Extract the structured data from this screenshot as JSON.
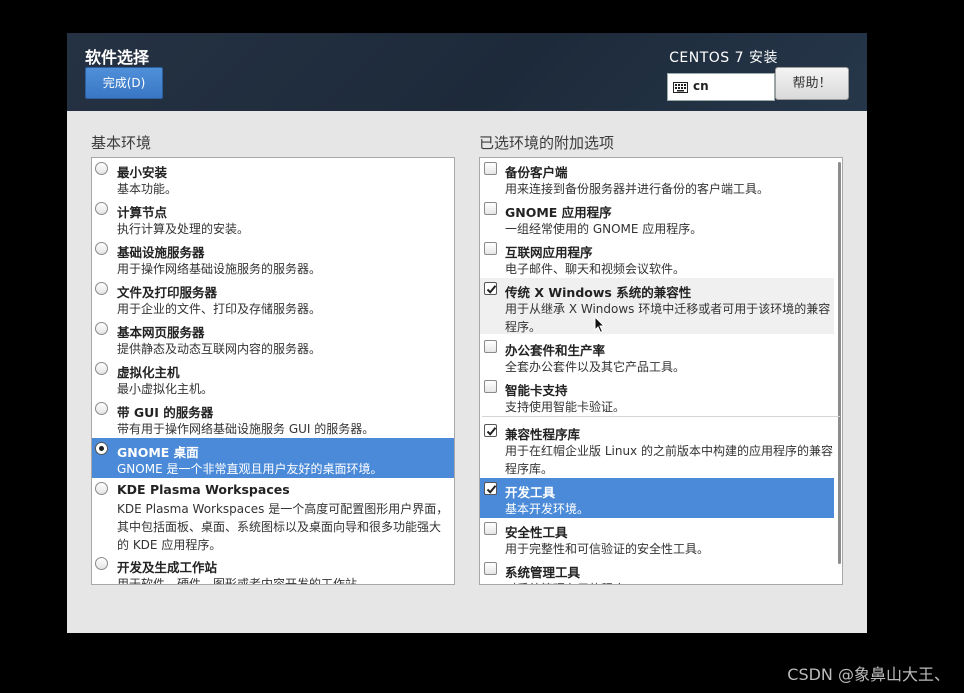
{
  "header": {
    "title": "软件选择",
    "done_label": "完成(D)",
    "product": "CENTOS 7 安装",
    "keyboard_layout": "cn",
    "help_label": "帮助！"
  },
  "base_env": {
    "label": "基本环境",
    "selected_index": 7,
    "items": [
      {
        "name": "最小安装",
        "desc": "基本功能。"
      },
      {
        "name": "计算节点",
        "desc": "执行计算及处理的安装。"
      },
      {
        "name": "基础设施服务器",
        "desc": "用于操作网络基础设施服务的服务器。"
      },
      {
        "name": "文件及打印服务器",
        "desc": "用于企业的文件、打印及存储服务器。"
      },
      {
        "name": "基本网页服务器",
        "desc": "提供静态及动态互联网内容的服务器。"
      },
      {
        "name": "虚拟化主机",
        "desc": "最小虚拟化主机。"
      },
      {
        "name": "带 GUI 的服务器",
        "desc": "带有用于操作网络基础设施服务 GUI 的服务器。"
      },
      {
        "name": "GNOME 桌面",
        "desc": "GNOME 是一个非常直观且用户友好的桌面环境。"
      },
      {
        "name": "KDE Plasma Workspaces",
        "desc": "KDE Plasma Workspaces 是一个高度可配置图形用户界面，其中包括面板、桌面、系统图标以及桌面向导和很多功能强大的 KDE 应用程序。"
      },
      {
        "name": "开发及生成工作站",
        "desc": "用于软件、硬件、图形或者内容开发的工作站。"
      }
    ]
  },
  "addons": {
    "label": "已选环境的附加选项",
    "items": [
      {
        "name": "备份客户端",
        "desc": "用来连接到备份服务器并进行备份的客户端工具。",
        "checked": false
      },
      {
        "name": "GNOME 应用程序",
        "desc": "一组经常使用的 GNOME 应用程序。",
        "checked": false
      },
      {
        "name": "互联网应用程序",
        "desc": "电子邮件、聊天和视频会议软件。",
        "checked": false
      },
      {
        "name": "传统 X Windows 系统的兼容性",
        "desc": "用于从继承 X Windows 环境中迁移或者可用于该环境的兼容程序。",
        "checked": true
      },
      {
        "name": "办公套件和生产率",
        "desc": "全套办公套件以及其它产品工具。",
        "checked": false
      },
      {
        "name": "智能卡支持",
        "desc": "支持使用智能卡验证。",
        "checked": false
      },
      {
        "name": "兼容性程序库",
        "desc": "用于在红帽企业版 Linux 的之前版本中构建的应用程序的兼容程序库。",
        "checked": true
      },
      {
        "name": "开发工具",
        "desc": "基本开发环境。",
        "checked": true
      },
      {
        "name": "安全性工具",
        "desc": "用于完整性和可信验证的安全性工具。",
        "checked": false
      },
      {
        "name": "系统管理工具",
        "desc": "对系统管理有用的程序。",
        "checked": false
      }
    ]
  },
  "watermark": "CSDN @象鼻山大王、",
  "colors": {
    "accent": "#4a8ad8",
    "header": "#1f2c3c"
  }
}
